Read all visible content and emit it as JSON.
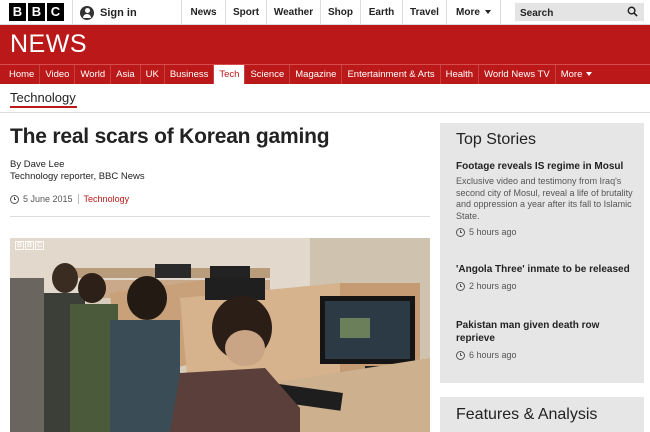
{
  "masthead": {
    "logo_letters": [
      "B",
      "B",
      "C"
    ],
    "signin_label": "Sign in",
    "nav": [
      "News",
      "Sport",
      "Weather",
      "Shop",
      "Earth",
      "Travel"
    ],
    "more_label": "More",
    "search_placeholder": "Search"
  },
  "banner": {
    "title": "NEWS"
  },
  "section_nav": {
    "items": [
      "Home",
      "Video",
      "World",
      "Asia",
      "UK",
      "Business",
      "Tech",
      "Science",
      "Magazine",
      "Entertainment & Arts",
      "Health",
      "World News TV"
    ],
    "active": "Tech",
    "more_label": "More"
  },
  "section_label": "Technology",
  "article": {
    "headline": "The real scars of Korean gaming",
    "author": "By Dave Lee",
    "author_role": "Technology reporter, BBC News",
    "date": "5 June 2015",
    "tag": "Technology",
    "image_watermark": [
      "B",
      "B",
      "C"
    ]
  },
  "sidebar": {
    "title": "Top Stories",
    "stories": [
      {
        "title": "Footage reveals IS regime in Mosul",
        "summary": "Exclusive video and testimony from Iraq's second city of Mosul, reveal a life of brutality and oppression a year after its fall to Islamic State.",
        "time": "5 hours ago"
      },
      {
        "title": "'Angola Three' inmate to be released",
        "time": "2 hours ago"
      },
      {
        "title": "Pakistan man given death row reprieve",
        "time": "6 hours ago"
      }
    ],
    "features_title": "Features & Analysis"
  },
  "colors": {
    "brand_red": "#bb1919",
    "sidebar_bg": "#e6e6e6"
  }
}
